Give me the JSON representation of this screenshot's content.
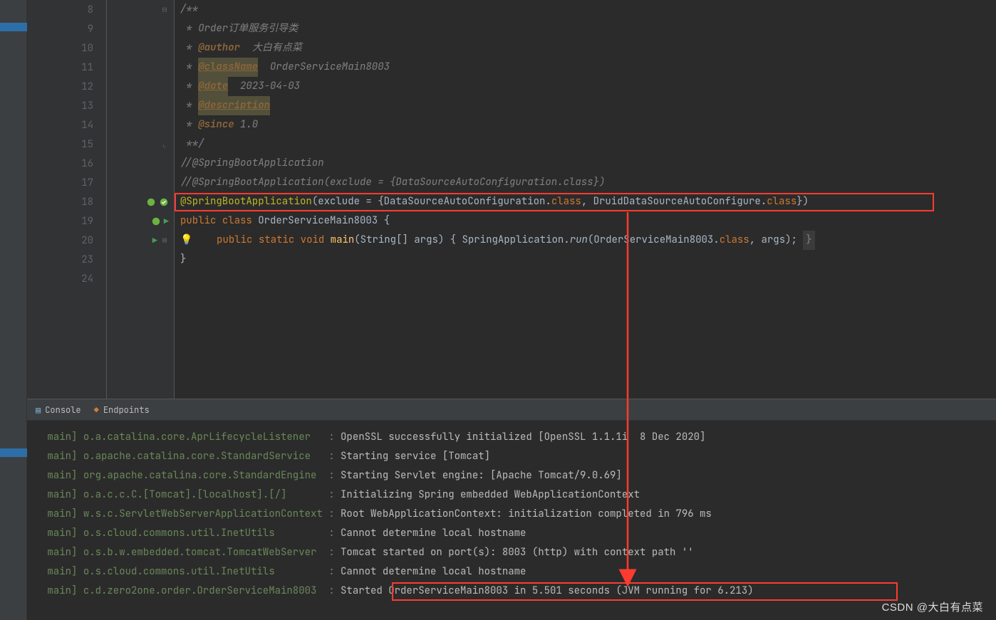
{
  "editor": {
    "lines": [
      {
        "n": "8"
      },
      {
        "n": "9"
      },
      {
        "n": "10"
      },
      {
        "n": "11"
      },
      {
        "n": "12"
      },
      {
        "n": "13"
      },
      {
        "n": "14"
      },
      {
        "n": "15"
      },
      {
        "n": "16"
      },
      {
        "n": "17"
      },
      {
        "n": "18"
      },
      {
        "n": "19"
      },
      {
        "n": "20"
      },
      {
        "n": "23"
      },
      {
        "n": "24"
      }
    ],
    "l8": "/**",
    "l9_pre": " * Order",
    "l9_rest": "订单服务引导类",
    "l10_tag": "@author",
    "l10_val": "  大白有点菜",
    "l11_tag": "@className",
    "l11_val": "  OrderServiceMain8003",
    "l12_tag": "@date",
    "l12_val": "  2023-04-03",
    "l13_tag": "@description",
    "l14_tag": "@since",
    "l14_val": " 1.0",
    "l15": " **/",
    "l16": "//@SpringBootApplication",
    "l17": "//@SpringBootApplication(exclude = {DataSourceAutoConfiguration.class})",
    "l18_ann": "@SpringBootApplication",
    "l18_p1": "(exclude = {DataSourceAutoConfiguration.",
    "l18_cls1": "class",
    "l18_p2": ", DruidDataSourceAutoConfigure.",
    "l18_cls2": "class",
    "l18_p3": "})",
    "l19_kw1": "public ",
    "l19_kw2": "class ",
    "l19_name": "OrderServiceMain8003 {",
    "l20_ind": "    ",
    "l20_kw1": "public ",
    "l20_kw2": "static ",
    "l20_kw3": "void ",
    "l20_m": "main",
    "l20_p1": "(String[] args) { SpringApplication.",
    "l20_run": "run",
    "l20_p2": "(OrderServiceMain8003.",
    "l20_cls": "class",
    "l20_p3": ", args); ",
    "l20_brace": "}",
    "l23": "}"
  },
  "panel": {
    "tab_console": "Console",
    "tab_endpoints": "Endpoints"
  },
  "console": {
    "rows": [
      {
        "thread": " main] ",
        "logger": "o.a.catalina.core.AprLifecycleListener   ",
        "sep": ": ",
        "msg": "OpenSSL successfully initialized [OpenSSL 1.1.1i  8 Dec 2020]"
      },
      {
        "thread": " main] ",
        "logger": "o.apache.catalina.core.StandardService   ",
        "sep": ": ",
        "msg": "Starting service [Tomcat]"
      },
      {
        "thread": " main] ",
        "logger": "org.apache.catalina.core.StandardEngine  ",
        "sep": ": ",
        "msg": "Starting Servlet engine: [Apache Tomcat/9.0.69]"
      },
      {
        "thread": " main] ",
        "logger": "o.a.c.c.C.[Tomcat].[localhost].[/]       ",
        "sep": ": ",
        "msg": "Initializing Spring embedded WebApplicationContext"
      },
      {
        "thread": " main] ",
        "logger": "w.s.c.ServletWebServerApplicationContext ",
        "sep": ": ",
        "msg": "Root WebApplicationContext: initialization completed in 796 ms"
      },
      {
        "thread": " main] ",
        "logger": "o.s.cloud.commons.util.InetUtils         ",
        "sep": ": ",
        "msg": "Cannot determine local hostname"
      },
      {
        "thread": " main] ",
        "logger": "o.s.b.w.embedded.tomcat.TomcatWebServer  ",
        "sep": ": ",
        "msg": "Tomcat started on port(s): 8003 (http) with context path ''"
      },
      {
        "thread": " main] ",
        "logger": "o.s.cloud.commons.util.InetUtils         ",
        "sep": ": ",
        "msg": "Cannot determine local hostname"
      },
      {
        "thread": " main] ",
        "logger": "c.d.zero2one.order.OrderServiceMain8003  ",
        "sep": ": ",
        "msg": "Started OrderServiceMain8003 in 5.501 seconds (JVM running for 6.213)"
      }
    ]
  },
  "watermark": "CSDN @大白有点菜"
}
